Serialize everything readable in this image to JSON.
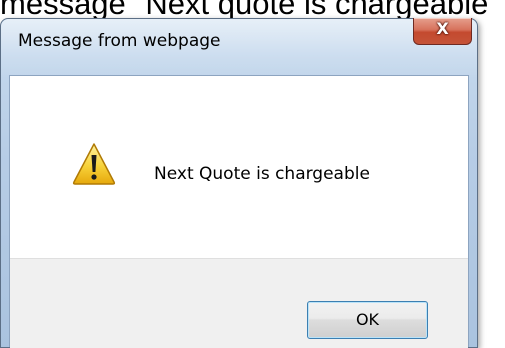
{
  "caption": {
    "text": "message \"Next quote is chargeable\""
  },
  "dialog": {
    "title": "Message from webpage",
    "close_label": "X",
    "message": "Next Quote is chargeable",
    "ok_label": "OK",
    "icon": "warning-icon"
  },
  "colors": {
    "close_button": "#c9503a",
    "ok_border": "#3c7fb1",
    "frame": "#b7cde6"
  }
}
